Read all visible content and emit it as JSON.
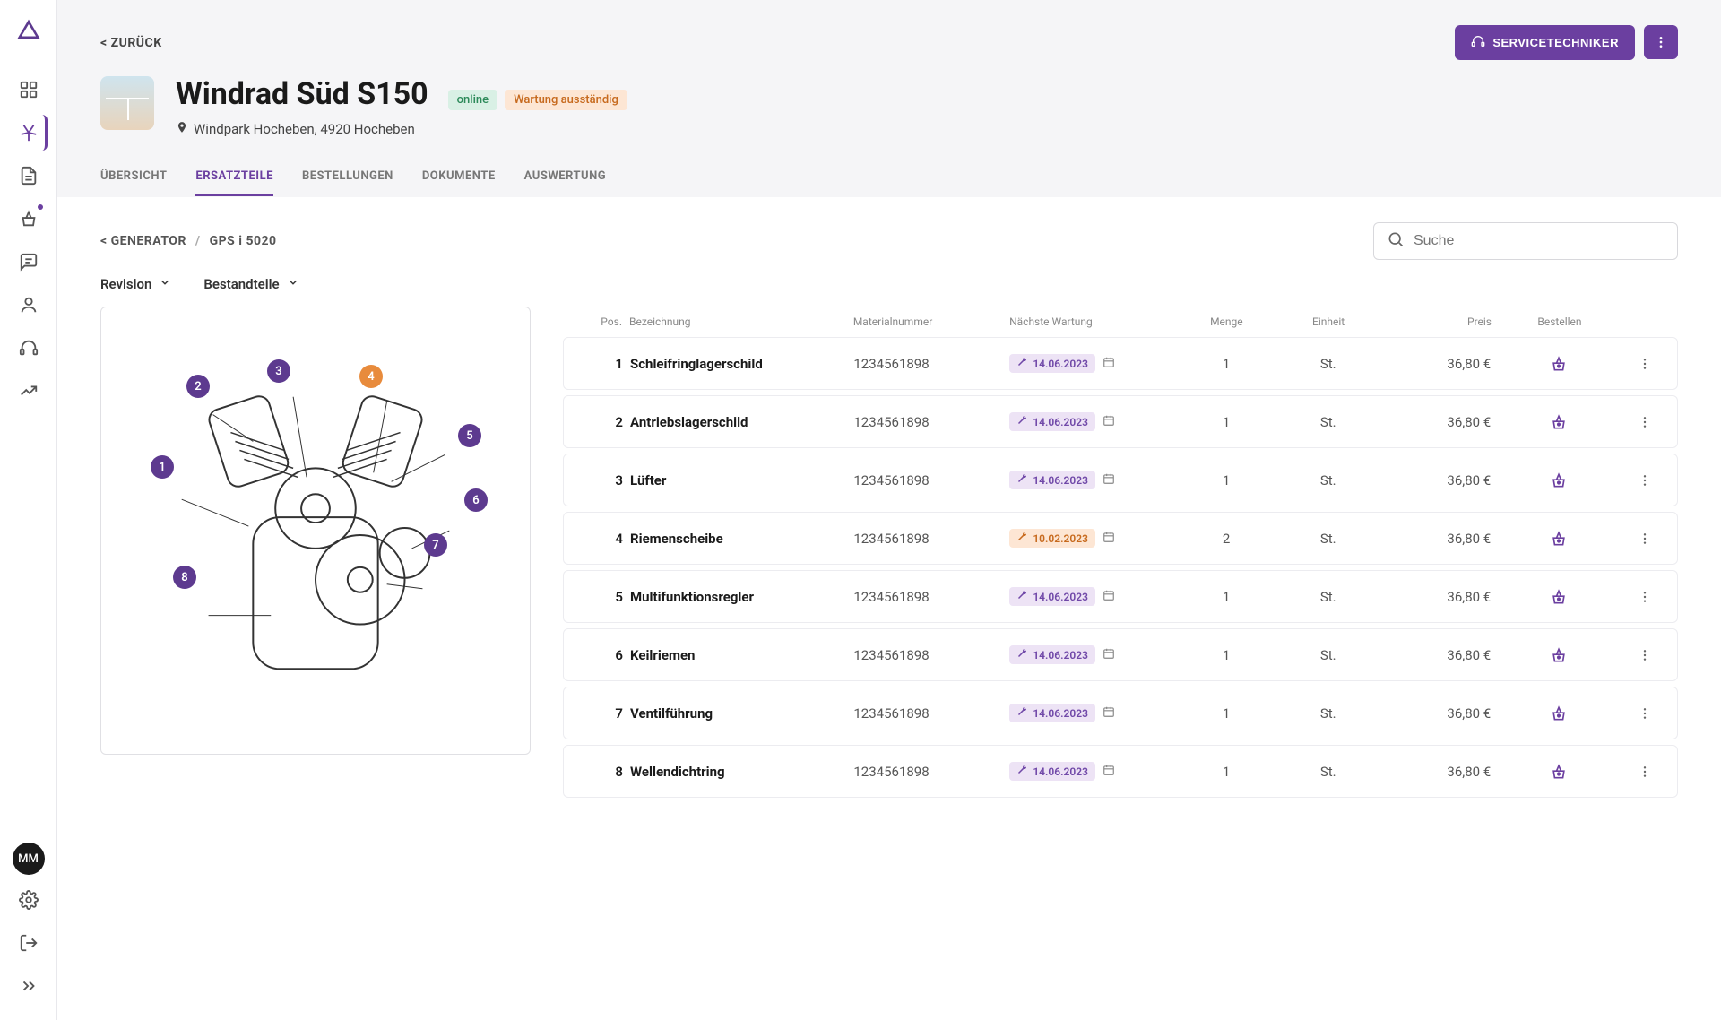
{
  "colors": {
    "accent": "#6b3fa0",
    "warn": "#e88b3c"
  },
  "sidebar": {
    "avatar": "MM"
  },
  "header": {
    "back": "< ZURÜCK",
    "title": "Windrad Süd S150",
    "badge_online": "online",
    "badge_warn": "Wartung ausständig",
    "location": "Windpark Hocheben, 4920 Hocheben",
    "btn_service": "SERVICETECHNIKER"
  },
  "tabs": [
    "ÜBERSICHT",
    "ERSATZTEILE",
    "BESTELLUNGEN",
    "DOKUMENTE",
    "AUSWERTUNG"
  ],
  "breadcrumb": {
    "prefix": "< GENERATOR",
    "current": "GPS i 5020"
  },
  "search": {
    "placeholder": "Suche"
  },
  "filters": {
    "revision": "Revision",
    "bestandteile": "Bestandteile"
  },
  "columns": {
    "pos": "Pos.",
    "name": "Bezeichnung",
    "material": "Materialnummer",
    "wartung": "Nächste Wartung",
    "menge": "Menge",
    "einheit": "Einheit",
    "preis": "Preis",
    "bestellen": "Bestellen"
  },
  "diagram_markers": [
    "1",
    "2",
    "3",
    "4",
    "5",
    "6",
    "7",
    "8"
  ],
  "rows": [
    {
      "pos": "1",
      "name": "Schleifringlagerschild",
      "material": "1234561898",
      "date": "14.06.2023",
      "warn": false,
      "menge": "1",
      "einheit": "St.",
      "preis": "36,80 €"
    },
    {
      "pos": "2",
      "name": "Antriebslagerschild",
      "material": "1234561898",
      "date": "14.06.2023",
      "warn": false,
      "menge": "1",
      "einheit": "St.",
      "preis": "36,80 €"
    },
    {
      "pos": "3",
      "name": "Lüfter",
      "material": "1234561898",
      "date": "14.06.2023",
      "warn": false,
      "menge": "1",
      "einheit": "St.",
      "preis": "36,80 €"
    },
    {
      "pos": "4",
      "name": "Riemenscheibe",
      "material": "1234561898",
      "date": "10.02.2023",
      "warn": true,
      "menge": "2",
      "einheit": "St.",
      "preis": "36,80 €"
    },
    {
      "pos": "5",
      "name": "Multifunktionsregler",
      "material": "1234561898",
      "date": "14.06.2023",
      "warn": false,
      "menge": "1",
      "einheit": "St.",
      "preis": "36,80 €"
    },
    {
      "pos": "6",
      "name": "Keilriemen",
      "material": "1234561898",
      "date": "14.06.2023",
      "warn": false,
      "menge": "1",
      "einheit": "St.",
      "preis": "36,80 €"
    },
    {
      "pos": "7",
      "name": "Ventilführung",
      "material": "1234561898",
      "date": "14.06.2023",
      "warn": false,
      "menge": "1",
      "einheit": "St.",
      "preis": "36,80 €"
    },
    {
      "pos": "8",
      "name": "Wellendichtring",
      "material": "1234561898",
      "date": "14.06.2023",
      "warn": false,
      "menge": "1",
      "einheit": "St.",
      "preis": "36,80 €"
    }
  ]
}
